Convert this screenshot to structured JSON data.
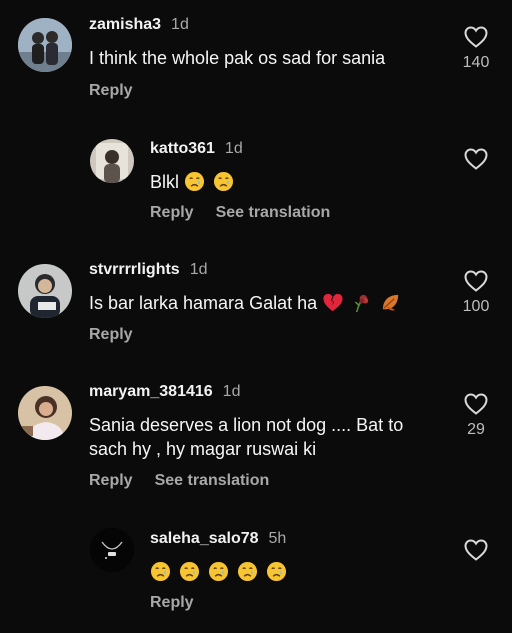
{
  "comments": [
    {
      "username": "zamisha3",
      "time": "1d",
      "text": "I think the whole pak os sad for sania",
      "likes": "140",
      "actions": [
        "Reply"
      ]
    },
    {
      "username": "katto361",
      "time": "1d",
      "text": "Blkl",
      "emojis": [
        "crying-face",
        "crying-face"
      ],
      "likes": "",
      "actions": [
        "Reply",
        "See translation"
      ]
    },
    {
      "username": "stvrrrrlights",
      "time": "1d",
      "text": "Is bar larka hamara Galat ha",
      "emojis": [
        "broken-heart",
        "wilted-flower",
        "fallen-leaf"
      ],
      "likes": "100",
      "actions": [
        "Reply"
      ]
    },
    {
      "username": "maryam_381416",
      "time": "1d",
      "text_lines": [
        "Sania deserves a lion not dog .... Bat to",
        "sach hy , hy magar ruswai ki"
      ],
      "likes": "29",
      "actions": [
        "Reply",
        "See translation"
      ]
    },
    {
      "username": "saleha_salo78",
      "time": "5h",
      "text": "",
      "emojis": [
        "crying-face",
        "crying-face",
        "crying-face",
        "crying-face",
        "crying-face"
      ],
      "likes": "",
      "actions": [
        "Reply"
      ]
    }
  ]
}
